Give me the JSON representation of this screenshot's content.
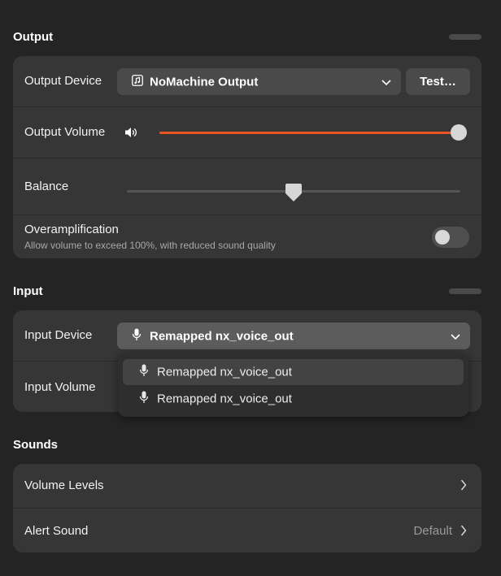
{
  "output": {
    "title": "Output",
    "device_label": "Output Device",
    "device_value": "NoMachine Output",
    "test_button": "Test…",
    "volume_label": "Output Volume",
    "volume_level": 1.0,
    "balance_label": "Balance",
    "balance_level": 0.5,
    "overamp_label": "Overamplification",
    "overamp_desc": "Allow volume to exceed 100%, with reduced sound quality",
    "overamp_enabled": false
  },
  "input": {
    "title": "Input",
    "device_label": "Input Device",
    "device_value": "Remapped nx_voice_out",
    "volume_label": "Input Volume",
    "dropdown_options": [
      "Remapped nx_voice_out",
      "Remapped nx_voice_out"
    ]
  },
  "sounds": {
    "title": "Sounds",
    "volume_levels_label": "Volume Levels",
    "alert_sound_label": "Alert Sound",
    "alert_sound_value": "Default"
  },
  "colors": {
    "accent": "#e95420",
    "background": "#242424",
    "card": "#363636"
  }
}
